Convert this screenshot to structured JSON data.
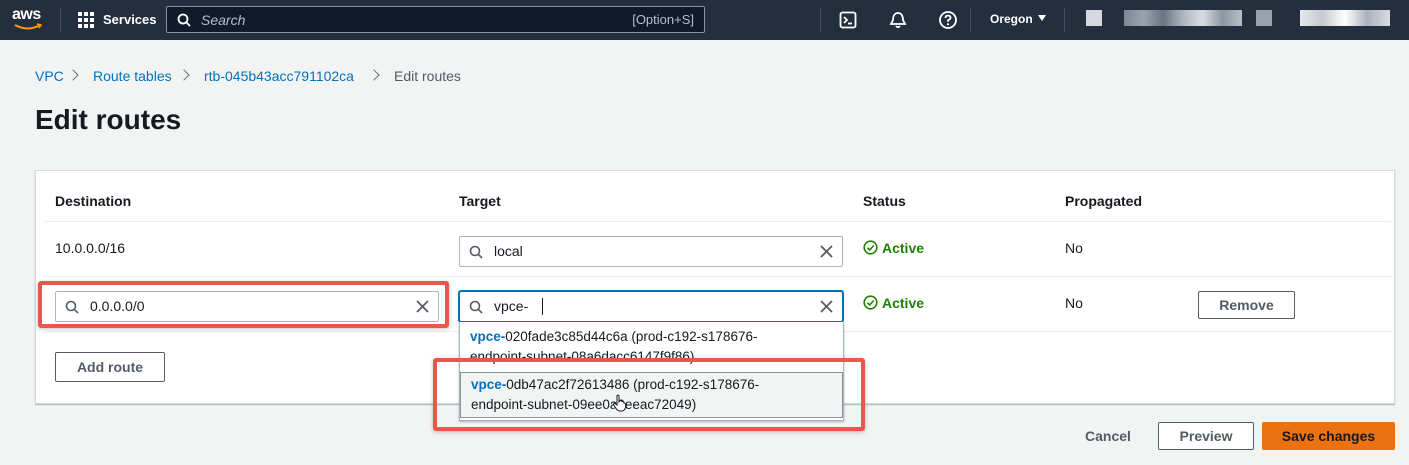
{
  "topnav": {
    "logo": "aws",
    "services_label": "Services",
    "search_placeholder": "Search",
    "search_shortcut": "[Option+S]",
    "cloudshell_icon": "cloudshell-icon",
    "notifications_icon": "bell-icon",
    "help_icon": "help-icon",
    "region": "Oregon"
  },
  "breadcrumb": {
    "items": [
      "VPC",
      "Route tables",
      "rtb-045b43acc791102ca"
    ],
    "current": "Edit routes"
  },
  "page_title": "Edit routes",
  "table": {
    "headers": [
      "Destination",
      "Target",
      "Status",
      "Propagated"
    ],
    "rows": [
      {
        "destination": "10.0.0.0/16",
        "target": "local",
        "status": "Active",
        "propagated": "No"
      },
      {
        "destination": "0.0.0.0/0",
        "target": "vpce-",
        "status": "Active",
        "propagated": "No",
        "remove_label": "Remove"
      }
    ],
    "add_route_label": "Add route"
  },
  "dropdown": {
    "options": [
      {
        "match": "vpce-",
        "line1": "020fade3c85d44c6a (prod-c192-s178676-",
        "line2": "endpoint-subnet-08a6dacc6147f9f86)"
      },
      {
        "match": "vpce-",
        "line1": "0db47ac2f72613486 (prod-c192-s178676-",
        "line2": "endpoint-subnet-09ee0a9eeac72049)"
      }
    ]
  },
  "footer": {
    "cancel_label": "Cancel",
    "preview_label": "Preview",
    "save_label": "Save changes"
  },
  "colors": {
    "nav_bg": "#232f3e",
    "link": "#0073bb",
    "active_green": "#1d8102",
    "primary": "#ec7211",
    "highlight": "#e8574a"
  }
}
